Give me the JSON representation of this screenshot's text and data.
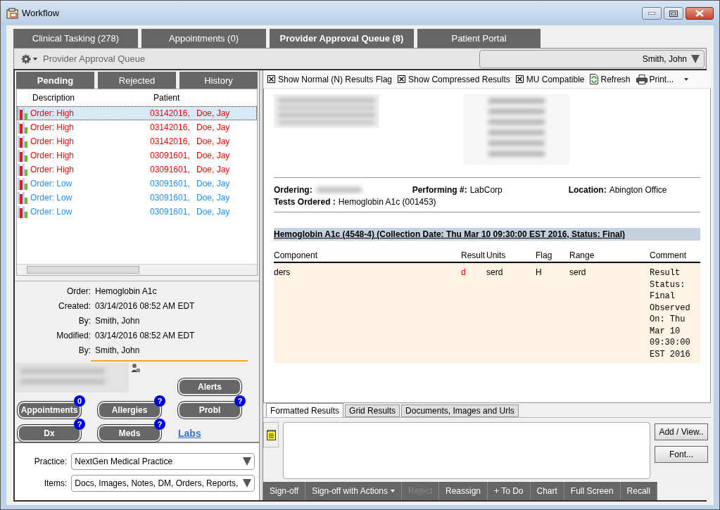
{
  "window": {
    "title": "Workflow"
  },
  "tabs": [
    {
      "label": "Clinical Tasking (278)",
      "selected": false
    },
    {
      "label": "Appointments (0)",
      "selected": false
    },
    {
      "label": "Provider Approval Queue (8)",
      "selected": true
    },
    {
      "label": "Patient Portal",
      "selected": false
    }
  ],
  "header": {
    "title": "Provider Approval Queue",
    "patient": "Smith, John"
  },
  "queue": {
    "tabs": [
      {
        "label": "Pending",
        "selected": true
      },
      {
        "label": "Rejected",
        "selected": false
      },
      {
        "label": "History",
        "selected": false
      }
    ],
    "columns": [
      "Description",
      "Patient"
    ],
    "rows": [
      {
        "description": "Order: High",
        "patient_id": "03142016,",
        "patient_name": "Doe, Jay",
        "color": "#ff0000",
        "selected": true
      },
      {
        "description": "Order: High",
        "patient_id": "03142016,",
        "patient_name": "Doe, Jay",
        "color": "#ff0000",
        "selected": false
      },
      {
        "description": "Order: High",
        "patient_id": "03142016,",
        "patient_name": "Doe, Jay",
        "color": "#ff0000",
        "selected": false
      },
      {
        "description": "Order: High",
        "patient_id": "03091601,",
        "patient_name": "Doe, Jay",
        "color": "#ff0000",
        "selected": false
      },
      {
        "description": "Order: High",
        "patient_id": "03091601,",
        "patient_name": "Doe, Jay",
        "color": "#ff0000",
        "selected": false
      },
      {
        "description": "Order: Low",
        "patient_id": "03091601,",
        "patient_name": "Doe, Jay",
        "color": "#1e8fff",
        "selected": false
      },
      {
        "description": "Order: Low",
        "patient_id": "03091601,",
        "patient_name": "Doe, Jay",
        "color": "#1e8fff",
        "selected": false
      },
      {
        "description": "Order: Low",
        "patient_id": "03091601,",
        "patient_name": "Doe, Jay",
        "color": "#1e8fff",
        "selected": false
      }
    ]
  },
  "details": {
    "fields": [
      {
        "label": "Order:",
        "value": "Hemoglobin A1c"
      },
      {
        "label": "Created:",
        "value": "03/14/2016 08:52 AM EDT"
      },
      {
        "label": "By:",
        "value": "Smith, John"
      },
      {
        "label": "Modified:",
        "value": "03/14/2016 08:52 AM EDT"
      },
      {
        "label": "By:",
        "value": "Smith, John"
      }
    ],
    "buttons": [
      {
        "label": "Alerts"
      },
      {
        "label": "Appointments",
        "badge": "0"
      },
      {
        "label": "Allergies",
        "badge": "?"
      },
      {
        "label": "Probl",
        "badge": "?"
      },
      {
        "label": "Dx",
        "badge": "?"
      },
      {
        "label": "Meds",
        "badge": "?"
      }
    ],
    "link": "Labs"
  },
  "filters": [
    {
      "label": "Practice:",
      "value": "NextGen Medical Practice"
    },
    {
      "label": "Items:",
      "value": "Docs, Images, Notes, DM, Orders, Reports,"
    }
  ],
  "results": {
    "checkboxes": [
      {
        "label": "Show Normal (N) Results Flag",
        "checked": true
      },
      {
        "label": "Show Compressed Results",
        "checked": true
      },
      {
        "label": "MU Compatible",
        "checked": true
      }
    ],
    "refresh": "Refresh",
    "print": "Print...",
    "report": {
      "ordering_label": "Ordering:",
      "performing_label": "Performing #:",
      "performing": "LabCorp",
      "location_label": "Location:",
      "location": "Abington Office",
      "tests_label": "Tests Ordered :",
      "tests": "Hemoglobin A1c (001453)",
      "section": "Hemoglobin A1c (4548-4) (Collection Date: Thu Mar 10 09:30:00 EST 2016, Status: Final)",
      "columns": [
        "Component",
        "Result",
        "Units",
        "Flag",
        "Range",
        "Comment"
      ],
      "rows": [
        {
          "cells": [
            "ders",
            "d",
            "serd",
            "H",
            "serd",
            "Result Status: Final Observed On: Thu Mar 10 09:30:00 EST 2016"
          ],
          "abnormal": true
        }
      ]
    },
    "view_tabs": [
      {
        "label": "Formatted Results",
        "selected": true
      },
      {
        "label": "Grid Results",
        "selected": false
      },
      {
        "label": "Documents, Images and Urls",
        "selected": false
      }
    ],
    "note_buttons": [
      "Add / View..",
      "Font..."
    ]
  },
  "actions": [
    {
      "label": "Sign-off",
      "disabled": false
    },
    {
      "label": "Sign-off with Actions",
      "disabled": false,
      "menu": true
    },
    {
      "label": "Reject",
      "disabled": true
    },
    {
      "label": "Reassign",
      "disabled": false
    },
    {
      "label": "+ To Do",
      "disabled": false
    },
    {
      "label": "Chart",
      "disabled": false
    },
    {
      "label": "Full Screen",
      "disabled": false
    },
    {
      "label": "Recall",
      "disabled": false
    }
  ]
}
